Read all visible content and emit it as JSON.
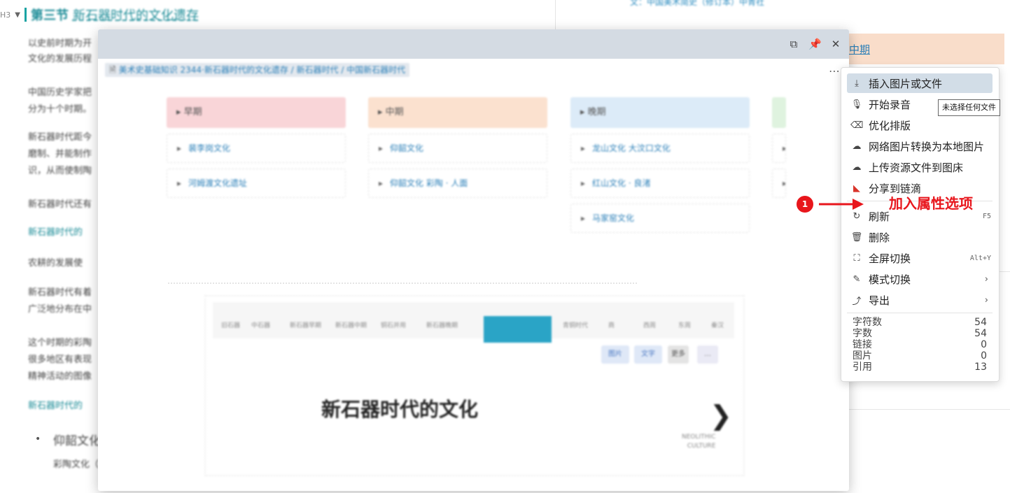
{
  "background": {
    "heading": {
      "level": "H3",
      "title_a": "第三节",
      "title_b": "新石器时代的文化遗存"
    },
    "top_right_text": "文：中国美术简史（修订本）中青社",
    "right_card_label": "中期",
    "paragraphs": [
      "以史前时期为开",
      "文化的发展历程",
      "中国历史学家把",
      "分为十个时期。",
      "新石器时代距今",
      "磨制、并能制作",
      "识，从而使制陶",
      "新石器时代还有",
      "新石器时代的",
      "农耕的发展使",
      "新石器时代有着",
      "广泛地分布在中",
      "这个时期的彩陶",
      "很多地区有表现",
      "精神活动的图像",
      "新石器时代的",
      "仰韶文化",
      "彩陶文化（"
    ]
  },
  "window": {
    "breadcrumb": "美术史基础知识 2344·新石器时代的文化遗存 / 新石器时代 / 中国新石器时代",
    "kanban": [
      {
        "header": "早期",
        "items": [
          "裴李岗文化",
          "河姆渡文化遗址"
        ]
      },
      {
        "header": "中期",
        "items": [
          "仰韶文化",
          "仰韶文化 彩陶 · 人面"
        ]
      },
      {
        "header": "晚期",
        "items": [
          "龙山文化 大汶口文化",
          "红山文化 · 良渚",
          "马家窑文化"
        ]
      },
      {
        "header": "",
        "items": [
          "",
          ""
        ]
      }
    ],
    "embed": {
      "timeline_labels": [
        "旧石器",
        "中石器",
        "新石器早期",
        "新石器中期",
        "铜石并用",
        "新石器晚期",
        "青铜时代",
        "商",
        "西周",
        "东周",
        "秦汉"
      ],
      "buttons": [
        "图片",
        "文字",
        "更多",
        "…"
      ],
      "title": "新石器时代的文化",
      "arrow": "❯",
      "small_text": [
        "NEOLITHIC",
        "CULTURE"
      ]
    }
  },
  "menu": {
    "items": [
      {
        "icon": "download-icon",
        "glyph": "⤓",
        "label": "插入图片或文件",
        "shortcut": "",
        "submenu": false
      },
      {
        "icon": "microphone-icon",
        "glyph": "🎙",
        "label": "开始录音",
        "shortcut": "",
        "submenu": false
      },
      {
        "icon": "eraser-icon",
        "glyph": "⌫",
        "label": "优化排版",
        "shortcut": "",
        "submenu": false
      },
      {
        "icon": "cloud-download-icon",
        "glyph": "☁",
        "label": "网络图片转换为本地图片",
        "shortcut": "",
        "submenu": false
      },
      {
        "icon": "cloud-upload-icon",
        "glyph": "☁",
        "label": "上传资源文件到图床",
        "shortcut": "",
        "submenu": false
      },
      {
        "icon": "lianke-logo-icon",
        "glyph": "◣",
        "label": "分享到链滴",
        "shortcut": "",
        "submenu": false
      },
      {
        "icon": "refresh-icon",
        "glyph": "↻",
        "label": "刷新",
        "shortcut": "F5",
        "submenu": false
      },
      {
        "icon": "trash-icon",
        "glyph": "🗑",
        "label": "删除",
        "shortcut": "",
        "submenu": false
      },
      {
        "icon": "fullscreen-icon",
        "glyph": "⛶",
        "label": "全屏切换",
        "shortcut": "Alt+Y",
        "submenu": false
      },
      {
        "icon": "pencil-icon",
        "glyph": "✎",
        "label": "模式切换",
        "shortcut": "",
        "submenu": true
      },
      {
        "icon": "export-icon",
        "glyph": "⤴",
        "label": "导出",
        "shortcut": "",
        "submenu": true
      }
    ],
    "stats": [
      {
        "label": "字符数",
        "value": "54"
      },
      {
        "label": "字数",
        "value": "54"
      },
      {
        "label": "链接",
        "value": "0"
      },
      {
        "label": "图片",
        "value": "0"
      },
      {
        "label": "引用",
        "value": "13"
      }
    ]
  },
  "tooltip": "未选择任何文件",
  "annotation": {
    "number": "1",
    "text": "加入属性选项",
    "color": "#e8161c"
  },
  "colors": {
    "accent": "#1c8c97",
    "menu_active": "#d2dde7",
    "titlebar": "#d4dbe3"
  }
}
